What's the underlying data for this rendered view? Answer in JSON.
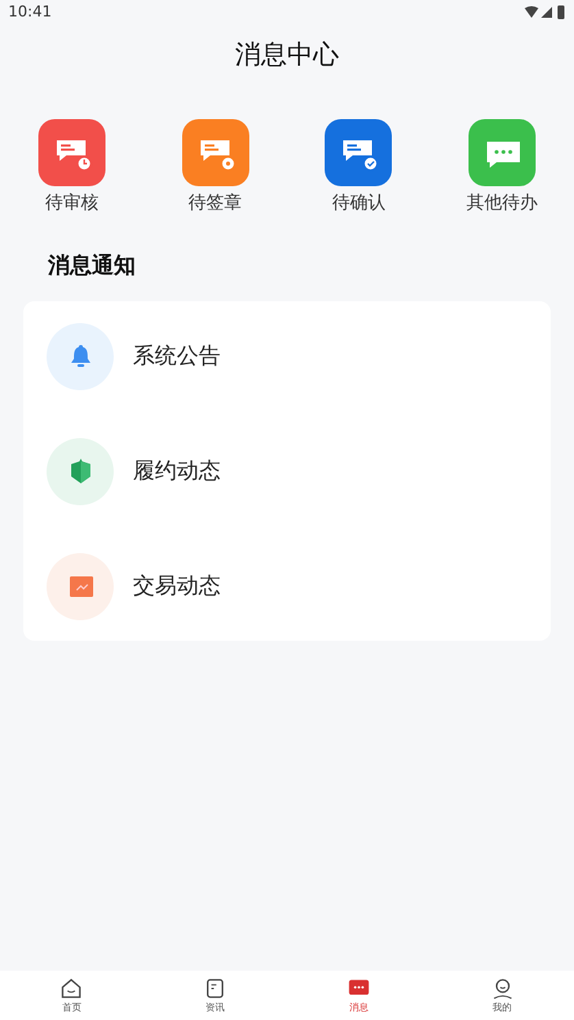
{
  "status_bar": {
    "time": "10:41"
  },
  "title": "消息中心",
  "shortcuts": [
    {
      "label": "待审核",
      "color": "#f24f4a",
      "kind": "clock"
    },
    {
      "label": "待签章",
      "color": "#fa7f22",
      "kind": "stamp"
    },
    {
      "label": "待确认",
      "color": "#1570de",
      "kind": "check"
    },
    {
      "label": "其他待办",
      "color": "#3bbf4c",
      "kind": "dots"
    }
  ],
  "section_title": "消息通知",
  "notifications": [
    {
      "label": "系统公告",
      "kind": "bell"
    },
    {
      "label": "履约动态",
      "kind": "shield"
    },
    {
      "label": "交易动态",
      "kind": "chart"
    }
  ],
  "tab_bar": [
    {
      "label": "首页",
      "kind": "home",
      "selected": false
    },
    {
      "label": "资讯",
      "kind": "news",
      "selected": false
    },
    {
      "label": "消息",
      "kind": "message",
      "selected": true
    },
    {
      "label": "我的",
      "kind": "profile",
      "selected": false
    }
  ]
}
